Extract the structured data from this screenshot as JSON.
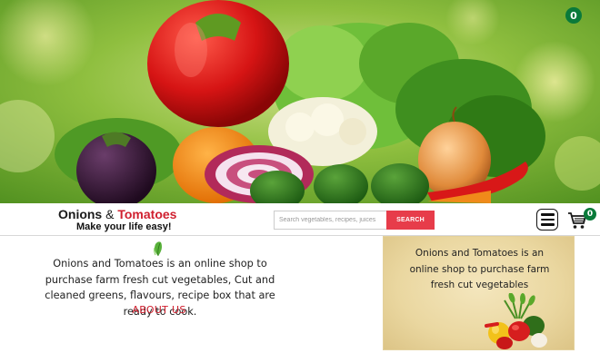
{
  "hero": {
    "notification_count": "0"
  },
  "header": {
    "brand_part1": "Onions",
    "brand_amp": "&",
    "brand_part2": "Tomatoes",
    "tagline": "Make your life easy!",
    "cart_count": "0"
  },
  "search": {
    "placeholder": "Search vegetables, recipes, juices",
    "button_label": "SEARCH"
  },
  "about": {
    "text": "Onions and Tomatoes is an online shop to purchase farm fresh cut vegetables, Cut and cleaned greens, flavours, recipe box that are ready to cook.",
    "link_label": "ABOUT US"
  },
  "promo": {
    "text": "Onions and Tomatoes is an online shop to purchase farm fresh cut vegetables"
  },
  "colors": {
    "brand_red": "#d0202f",
    "search_button": "#e73c4a",
    "badge_green": "#0a7a3a"
  }
}
